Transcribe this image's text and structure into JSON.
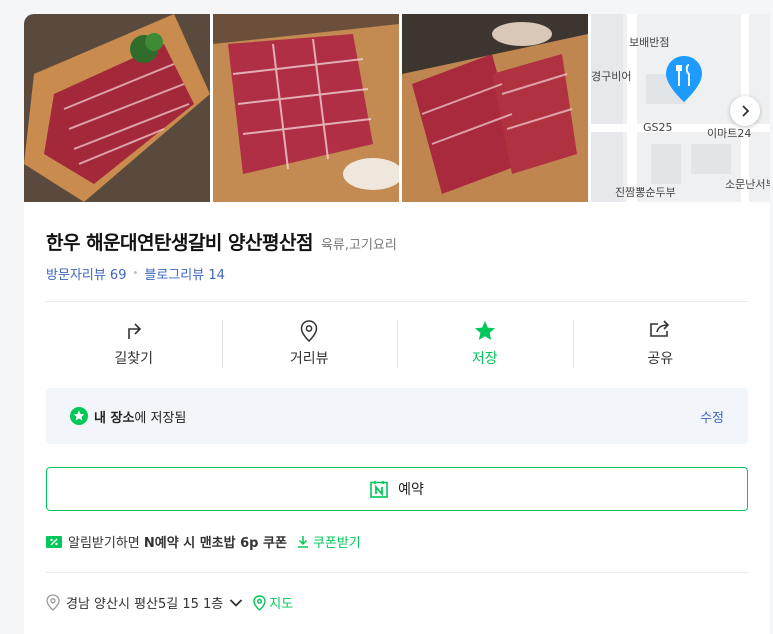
{
  "place": {
    "name": "한우 해운대연탄생갈비 양산평산점",
    "category": "육류,고기요리",
    "visitor_reviews": "방문자리뷰 69",
    "blog_reviews": "블로그리뷰 14"
  },
  "map": {
    "labels": [
      "보배반점",
      "경구비어",
      "GS25",
      "이마트24",
      "진짬뽕순두부",
      "소문난서부"
    ]
  },
  "actions": [
    {
      "label": "길찾기",
      "icon": "directions-icon"
    },
    {
      "label": "거리뷰",
      "icon": "location-pin-icon"
    },
    {
      "label": "저장",
      "icon": "star-icon"
    },
    {
      "label": "공유",
      "icon": "share-icon"
    }
  ],
  "saved": {
    "bold": "내 장소",
    "rest": "에 저장됨",
    "edit": "수정"
  },
  "reserve": {
    "label": "예약"
  },
  "coupon": {
    "prefix": "알림받기하면 ",
    "bold": "N예약 시 맨초밥 6p 쿠폰",
    "link": "쿠폰받기"
  },
  "address": {
    "text": "경남 양산시 평산5길 15 1층",
    "map_link": "지도"
  },
  "colors": {
    "accent": "#03c75a",
    "link": "#3c66c4",
    "pin": "#1e9bff"
  }
}
